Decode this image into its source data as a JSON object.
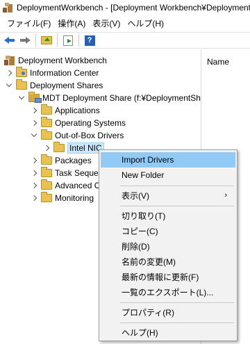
{
  "window": {
    "title": "DeploymentWorkbench - [Deployment Workbench¥Deployment"
  },
  "menubar": {
    "items": [
      "ファイル(F)",
      "操作(A)",
      "表示(V)",
      "ヘルプ(H)"
    ]
  },
  "toolbar": {
    "icons": [
      "back-arrow-icon",
      "forward-arrow-icon",
      "up-folder-icon",
      "export-list-icon",
      "help-icon"
    ],
    "help_glyph": "?"
  },
  "tree": {
    "root": "Deployment Workbench",
    "information_center": "Information Center",
    "deployment_shares": "Deployment Shares",
    "mdt_share": "MDT Deployment Share (f:¥DeploymentSh",
    "applications": "Applications",
    "operating_systems": "Operating Systems",
    "out_of_box_drivers": "Out-of-Box Drivers",
    "intel_nic": "Intel NIC",
    "packages": "Packages",
    "task_sequences": "Task Seque",
    "advanced": "Advanced C",
    "monitoring": "Monitoring"
  },
  "details": {
    "column_name": "Name"
  },
  "context_menu": {
    "import_drivers": "Import Drivers",
    "new_folder": "New Folder",
    "view": "表示(V)",
    "view_arrow": "›",
    "cut": "切り取り(T)",
    "copy": "コピー(C)",
    "delete": "削除(D)",
    "rename": "名前の変更(M)",
    "refresh": "最新の情報に更新(F)",
    "export_list": "一覧のエクスポート(L)...",
    "properties": "プロパティ(R)",
    "help": "ヘルプ(H)"
  }
}
